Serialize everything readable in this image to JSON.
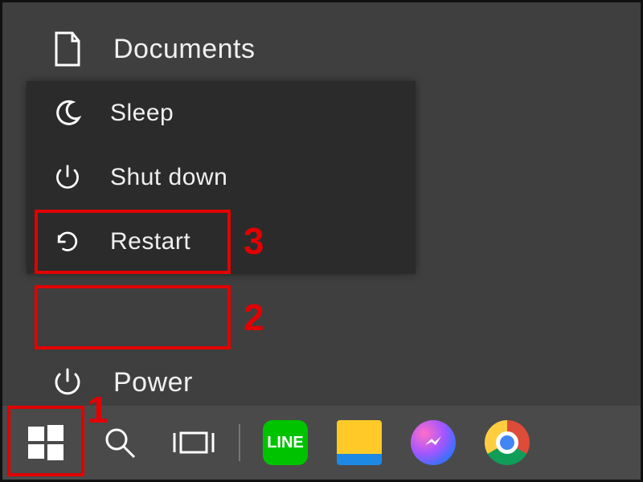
{
  "start_menu": {
    "documents_label": "Documents",
    "power_label": "Power"
  },
  "power_flyout": {
    "sleep_label": "Sleep",
    "shutdown_label": "Shut down",
    "restart_label": "Restart"
  },
  "taskbar": {
    "pinned": [
      "LINE",
      "File Explorer",
      "Messenger",
      "Chrome"
    ]
  },
  "annotations": {
    "step1": "1",
    "step2": "2",
    "step3": "3",
    "highlight_color": "#e20000"
  }
}
